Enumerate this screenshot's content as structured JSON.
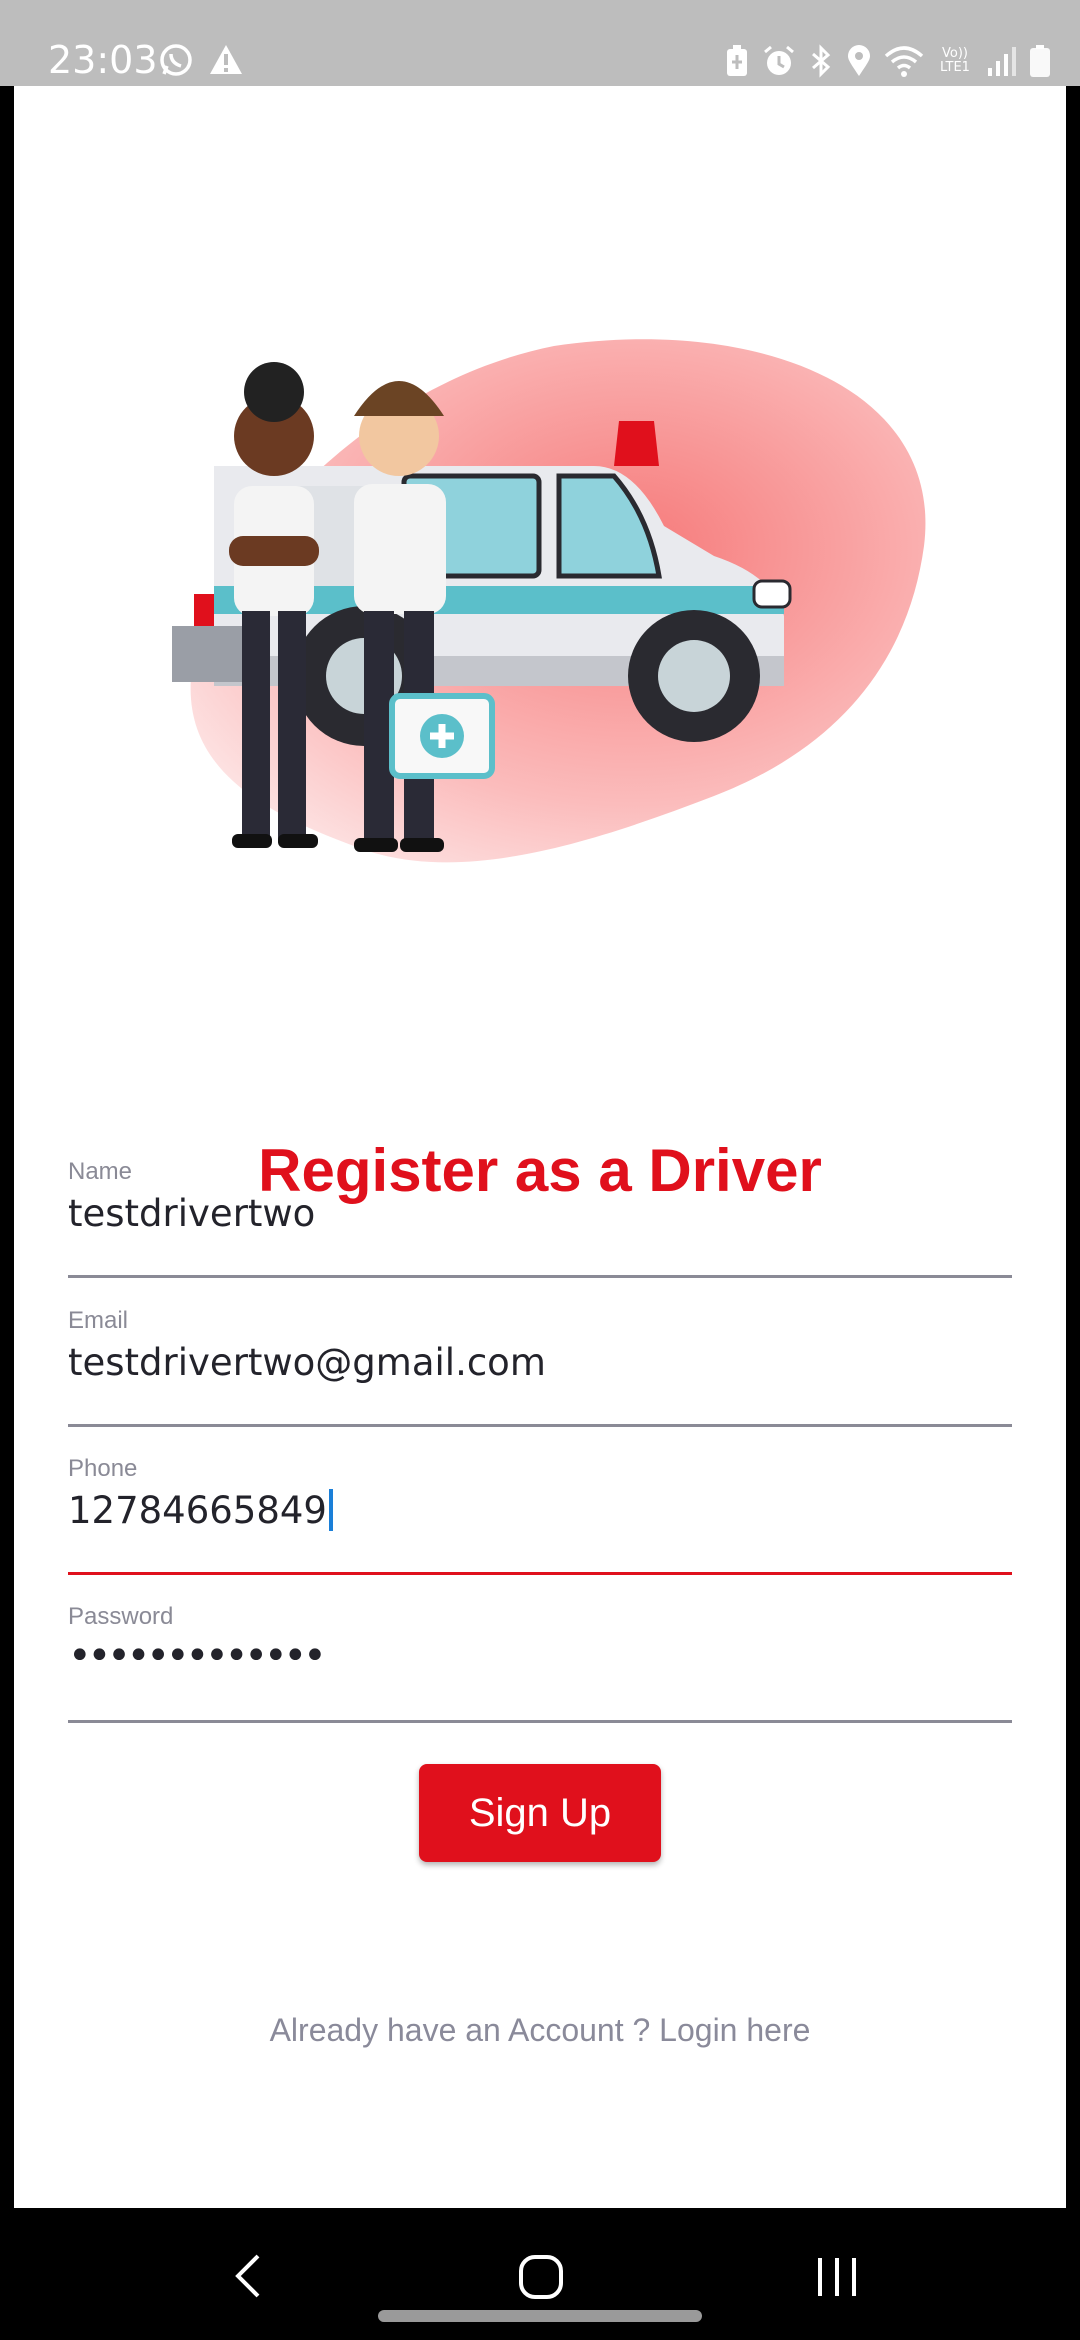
{
  "status_bar": {
    "time": "23:03",
    "left_icons": [
      "whatsapp-icon",
      "warning-icon"
    ],
    "right_icons": [
      "battery-saver-icon",
      "alarm-icon",
      "bluetooth-icon",
      "location-icon",
      "wifi-icon",
      "volte-icon",
      "signal-icon",
      "battery-icon"
    ],
    "volte_label": "Vo)) LTE1"
  },
  "hero": {
    "illustration": "ambulance-with-paramedics-illustration"
  },
  "form": {
    "title": "Register as a Driver",
    "name": {
      "label": "Name",
      "value": "testdrivertwo"
    },
    "email": {
      "label": "Email",
      "value": "testdrivertwo@gmail.com"
    },
    "phone": {
      "label": "Phone",
      "value": "12784665849"
    },
    "password": {
      "label": "Password",
      "value": "•••••••••••••"
    },
    "signup_label": "Sign Up",
    "login_link": "Already have an Account ? Login here"
  },
  "nav_bar": {
    "buttons": [
      "back-icon",
      "home-icon",
      "recents-icon"
    ]
  },
  "colors": {
    "accent": "#e0101c",
    "status_bar": "#bdbdbd",
    "label": "#8a8a96",
    "caret": "#1a7fd8"
  }
}
